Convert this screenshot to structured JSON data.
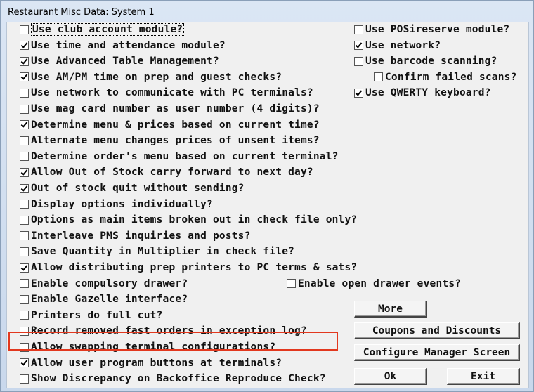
{
  "window": {
    "title": "Restaurant Misc Data:  System 1"
  },
  "left_options": [
    {
      "label": "Use club account module?",
      "checked": false,
      "focused": true
    },
    {
      "label": "Use time and attendance module?",
      "checked": true
    },
    {
      "label": "Use Advanced Table Management?",
      "checked": true
    },
    {
      "label": "Use AM/PM time on prep and guest checks?",
      "checked": true
    },
    {
      "label": "Use network to communicate with PC terminals?",
      "checked": false
    },
    {
      "label": "Use mag card number as user number (4 digits)?",
      "checked": false
    },
    {
      "label": "Determine menu & prices based on current time?",
      "checked": true
    },
    {
      "label": "Alternate menu changes prices of unsent items?",
      "checked": false
    },
    {
      "label": "Determine order's menu based on current terminal?",
      "checked": false
    },
    {
      "label": "Allow Out of Stock carry forward to next day?",
      "checked": true
    },
    {
      "label": "Out of stock quit without sending?",
      "checked": true
    },
    {
      "label": "Display options individually?",
      "checked": false
    },
    {
      "label": "Options as main items broken out in check file only?",
      "checked": false
    },
    {
      "label": "Interleave PMS inquiries and posts?",
      "checked": false
    },
    {
      "label": "Save Quantity in Multiplier in check file?",
      "checked": false
    },
    {
      "label": "Allow distributing prep printers to PC terms & sats?",
      "checked": true
    },
    {
      "label": "Enable compulsory drawer?",
      "checked": false
    },
    {
      "label": "Enable Gazelle interface?",
      "checked": false
    },
    {
      "label": "Printers do full cut?",
      "checked": false
    },
    {
      "label": "Record removed fast orders in exception log?",
      "checked": false
    },
    {
      "label": "Allow swapping terminal configurations?",
      "checked": false
    },
    {
      "label": "Allow user program buttons at terminals?",
      "checked": true
    },
    {
      "label": "Show Discrepancy on Backoffice Reproduce Check?",
      "checked": false
    }
  ],
  "right_options": [
    {
      "label": "Use POSireserve module?",
      "checked": false
    },
    {
      "label": "Use network?",
      "checked": true
    },
    {
      "label": "Use barcode scanning?",
      "checked": false
    },
    {
      "label": "Confirm failed scans?",
      "checked": false
    },
    {
      "label": "Use QWERTY keyboard?",
      "checked": true
    }
  ],
  "open_drawer_option": {
    "label": "Enable open drawer events?",
    "checked": false
  },
  "buttons": {
    "more": "More",
    "coupons": "Coupons and Discounts",
    "configure": "Configure Manager Screen",
    "ok": "Ok",
    "exit": "Exit"
  },
  "colors": {
    "highlight": "#e2381e",
    "dialog_bg": "#f0f0f0"
  }
}
